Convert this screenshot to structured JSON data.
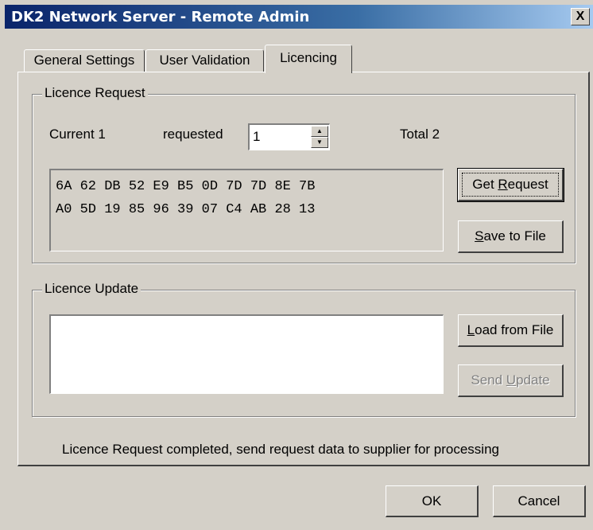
{
  "window": {
    "title": "DK2 Network Server - Remote Admin",
    "close_glyph": "X"
  },
  "tabs": [
    {
      "label": "General Settings",
      "active": false
    },
    {
      "label": "User Validation",
      "active": false
    },
    {
      "label": "Licencing",
      "active": true
    }
  ],
  "licence_request": {
    "group_title": "Licence Request",
    "current_label": "Current 1",
    "requested_label": "requested",
    "requested_value": "1",
    "total_label": "Total 2",
    "hex_lines": [
      "6A 62 DB 52 E9 B5 0D 7D 7D 8E 7B",
      "A0 5D 19 85 96 39 07 C4 AB 28 13"
    ],
    "get_request": {
      "pre": "Get ",
      "accel": "R",
      "post": "equest"
    },
    "save_to_file": {
      "pre": "",
      "accel": "S",
      "post": "ave to File"
    }
  },
  "licence_update": {
    "group_title": "Licence Update",
    "text_value": "",
    "load_from_file": {
      "pre": "",
      "accel": "L",
      "post": "oad from File"
    },
    "send_update": {
      "pre": "Send ",
      "accel": "U",
      "post": "pdate"
    }
  },
  "status_message": "Licence Request completed, send request data to supplier for processing",
  "footer": {
    "ok_label": "OK",
    "cancel_label": "Cancel"
  },
  "colors": {
    "face": "#d4d0c8",
    "title_gradient_start": "#0a246a",
    "title_gradient_end": "#a6caf0",
    "disabled_text": "#808080"
  }
}
